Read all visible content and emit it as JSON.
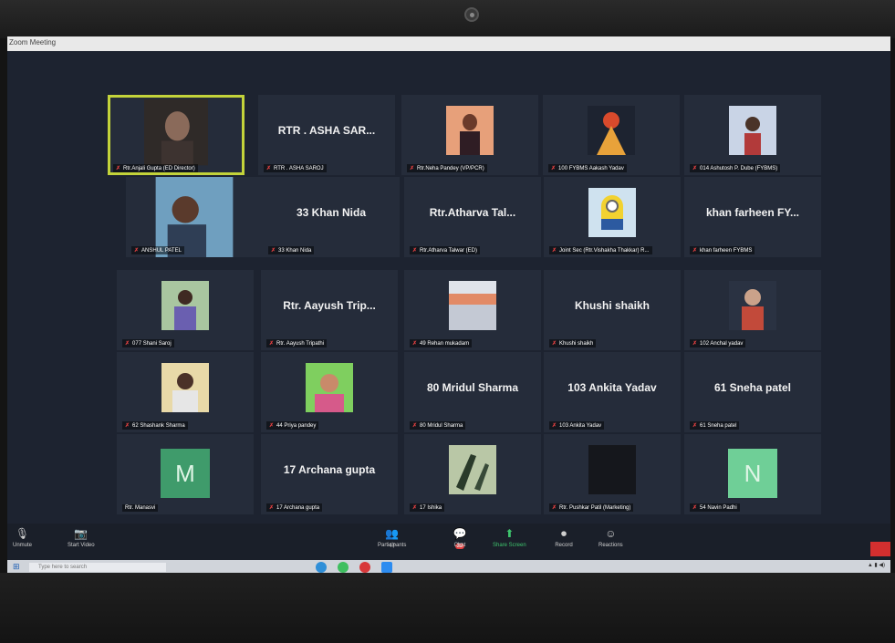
{
  "window": {
    "title": "Zoom Meeting"
  },
  "participants": [
    {
      "label": "Rtr.Anjali Gupta (ED Director)",
      "display": "",
      "active": true
    },
    {
      "label": "RTR . ASHA SAROJ",
      "display": "RTR . ASHA SAR..."
    },
    {
      "label": "Rtr.Neha Pandey (VP/PCR)",
      "display": ""
    },
    {
      "label": "100 FYBMS Aakash Yadav",
      "display": ""
    },
    {
      "label": "014 Ashutosh P. Dube (FYBMS)",
      "display": ""
    },
    {
      "label": "ANSHUL PATEL",
      "display": ""
    },
    {
      "label": "33 Khan Nida",
      "display": "33 Khan Nida"
    },
    {
      "label": "Rtr.Atharva Talwar (ED)",
      "display": "Rtr.Atharva Tal..."
    },
    {
      "label": "Joint Sec (Rtr.Vishakha Thakkar) R...",
      "display": ""
    },
    {
      "label": "khan farheen FYBMS",
      "display": "khan farheen FY..."
    },
    {
      "label": "077 Shani Saroj",
      "display": ""
    },
    {
      "label": "Rtr. Aayush Tripathi",
      "display": "Rtr. Aayush Trip..."
    },
    {
      "label": "49 Rehan mukadam",
      "display": ""
    },
    {
      "label": "Khushi shaikh",
      "display": "Khushi shaikh"
    },
    {
      "label": "102 Anchal yadav",
      "display": ""
    },
    {
      "label": "62 Shashank Sharma",
      "display": ""
    },
    {
      "label": "44 Priya pandey",
      "display": ""
    },
    {
      "label": "80 Mridul Sharma",
      "display": "80 Mridul Sharma"
    },
    {
      "label": "103 Ankita Yadav",
      "display": "103 Ankita Yadav"
    },
    {
      "label": "61 Sneha patel",
      "display": "61 Sneha patel"
    },
    {
      "label": "Rtr. Manasvi",
      "display": "",
      "avatar": "M"
    },
    {
      "label": "17 Archana gupta",
      "display": "17 Archana gupta"
    },
    {
      "label": "17 Ishika",
      "display": ""
    },
    {
      "label": "Rtr. Pushkar Patil (Marketing)",
      "display": ""
    },
    {
      "label": "54 Navin Padhi",
      "display": "",
      "avatar": "N"
    }
  ],
  "controls": {
    "unmute": "Unmute",
    "start_video": "Start Video",
    "participants": "Participants",
    "participants_count": "47",
    "chat": "Chat",
    "chat_badge": "32",
    "share_screen": "Share Screen",
    "record": "Record",
    "reactions": "Reactions"
  },
  "taskbar": {
    "search_placeholder": "Type here to search"
  },
  "colors": {
    "active_speaker": "#c3d33a",
    "mic_muted": "#e04040",
    "share_screen": "#3ec46d",
    "end": "#d32f2f"
  }
}
